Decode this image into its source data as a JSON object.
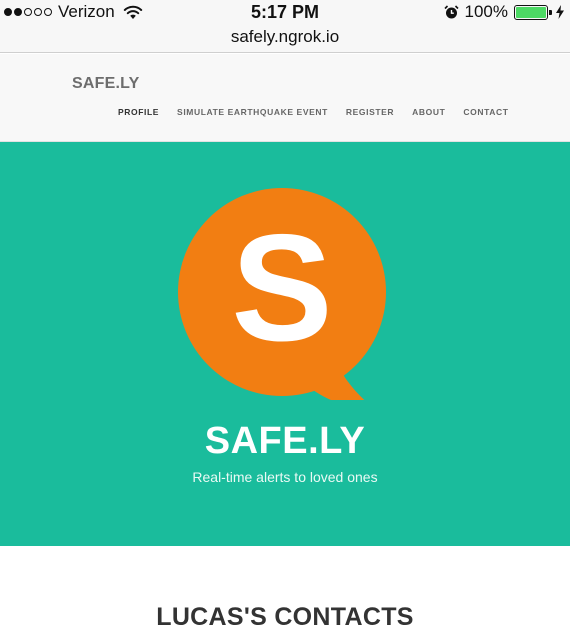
{
  "status_bar": {
    "carrier": "Verizon",
    "signal_bars_filled": 2,
    "signal_bars_total": 5,
    "wifi_icon": "wifi-icon",
    "time": "5:17 PM",
    "alarm_icon": "alarm-clock-icon",
    "battery_percent": "100%",
    "battery_level": 1.0,
    "charging_icon": "bolt-icon"
  },
  "browser": {
    "url": "safely.ngrok.io"
  },
  "navbar": {
    "brand": "SAFE.LY",
    "items": [
      {
        "label": "PROFILE",
        "active": true
      },
      {
        "label": "SIMULATE EARTHQUAKE EVENT",
        "active": false
      },
      {
        "label": "REGISTER",
        "active": false
      },
      {
        "label": "ABOUT",
        "active": false
      },
      {
        "label": "CONTACT",
        "active": false
      }
    ]
  },
  "hero": {
    "logo_letter": "S",
    "title": "SAFE.LY",
    "subtitle": "Real-time alerts to loved ones"
  },
  "contacts": {
    "heading": "LUCAS'S CONTACTS"
  },
  "colors": {
    "hero_bg": "#1abc9c",
    "logo_orange": "#f27e12",
    "battery_green": "#4cd964"
  }
}
